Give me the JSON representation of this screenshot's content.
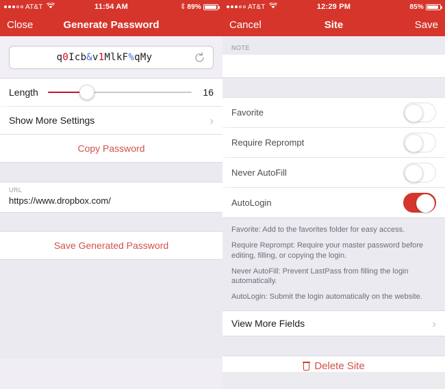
{
  "left": {
    "status_bar": {
      "signal_dots_filled": 3,
      "signal_dots_empty": 2,
      "carrier": "AT&T",
      "wifi_icon": "wifi-icon",
      "time": "11:54 AM",
      "bluetooth_icon": "bluetooth-icon",
      "battery_percent": "89%",
      "battery_level": 89
    },
    "nav": {
      "left_button": "Close",
      "title": "Generate Password"
    },
    "password": {
      "value": "q0Icb&v1MlkF%qMy",
      "segments": [
        {
          "text": "q",
          "color": "black"
        },
        {
          "text": "0",
          "color": "red"
        },
        {
          "text": "Icb",
          "color": "black"
        },
        {
          "text": "&",
          "color": "blue"
        },
        {
          "text": "v",
          "color": "black"
        },
        {
          "text": "1",
          "color": "red"
        },
        {
          "text": "MlkF",
          "color": "black"
        },
        {
          "text": "%",
          "color": "blue"
        },
        {
          "text": "qMy",
          "color": "black"
        }
      ],
      "refresh_icon": "refresh-icon"
    },
    "length": {
      "label": "Length",
      "value": "16",
      "slider_percent": 27,
      "min": 4,
      "max": 60
    },
    "show_more_settings": {
      "label": "Show More Settings",
      "chevron": "chevron-right-icon"
    },
    "copy_password_label": "Copy Password",
    "url_field": {
      "label": "URL",
      "value": "https://www.dropbox.com/"
    },
    "save_generated_password_label": "Save Generated Password"
  },
  "right": {
    "status_bar": {
      "signal_dots_filled": 3,
      "signal_dots_empty": 2,
      "carrier": "AT&T",
      "wifi_icon": "wifi-icon",
      "time": "12:29 PM",
      "battery_percent": "85%",
      "battery_level": 85
    },
    "nav": {
      "left_button": "Cancel",
      "title": "Site",
      "right_button": "Save"
    },
    "note": {
      "label": "NOTE",
      "value": ""
    },
    "toggles": [
      {
        "label": "Favorite",
        "on": false
      },
      {
        "label": "Require Reprompt",
        "on": false
      },
      {
        "label": "Never AutoFill",
        "on": false
      },
      {
        "label": "AutoLogin",
        "on": true
      }
    ],
    "help_texts": [
      "Favorite: Add to the favorites folder for easy access.",
      "Require Reprompt: Require your master password before editing, filling, or copying the login.",
      "Never AutoFill: Prevent LastPass from filling the login automatically.",
      "AutoLogin: Submit the login automatically on the website."
    ],
    "view_more_fields": {
      "label": "View More Fields",
      "chevron": "chevron-right-icon"
    },
    "delete_site": {
      "label": "Delete Site",
      "icon": "trash-icon"
    }
  },
  "colors": {
    "brand_red": "#d6352b",
    "action_red": "#d0514b",
    "slider_red": "#c8102e",
    "band_gray": "#eceaf1",
    "text_dark": "#1b1b1b",
    "text_muted": "#6d6c74"
  }
}
